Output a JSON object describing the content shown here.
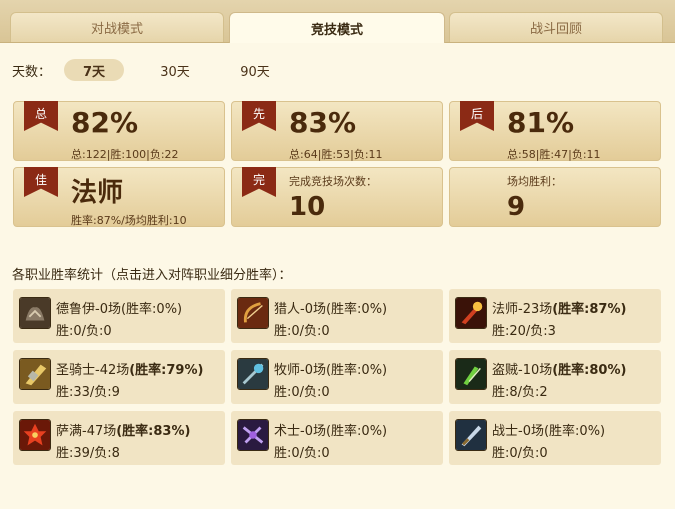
{
  "tabs": [
    {
      "label": "对战模式",
      "active": false
    },
    {
      "label": "竞技模式",
      "active": true
    },
    {
      "label": "战斗回顾",
      "active": false
    }
  ],
  "days": {
    "label": "天数：",
    "options": [
      {
        "label": "7天",
        "active": true
      },
      {
        "label": "30天",
        "active": false
      },
      {
        "label": "90天",
        "active": false
      }
    ]
  },
  "stats": {
    "total": {
      "badge": "总",
      "rate": "82%",
      "detail": "总:122|胜:100|负:22"
    },
    "first": {
      "badge": "先",
      "rate": "83%",
      "detail": "总:64|胜:53|负:11"
    },
    "second": {
      "badge": "后",
      "rate": "81%",
      "detail": "总:58|胜:47|负:11"
    },
    "best": {
      "badge": "佳",
      "class": "法师",
      "detail": "胜率:87%/场均胜利:10"
    },
    "complete": {
      "badge": "完",
      "label": "完成竞技场次数：",
      "value": "10"
    },
    "avg": {
      "label": "场均胜利：",
      "value": "9"
    }
  },
  "section_title": "各职业胜率统计（点击进入对阵职业细分胜率）：",
  "classes": [
    {
      "name": "德鲁伊-0场",
      "rate": "(胜率:0%)",
      "wl": "胜:0/负:0",
      "icon": "druid-icon",
      "bold": false
    },
    {
      "name": "猎人-0场",
      "rate": "(胜率:0%)",
      "wl": "胜:0/负:0",
      "icon": "hunter-icon",
      "bold": false
    },
    {
      "name": "法师-23场",
      "rate": "(胜率:87%)",
      "wl": "胜:20/负:3",
      "icon": "mage-icon",
      "bold": true
    },
    {
      "name": "圣骑士-42场",
      "rate": "(胜率:79%)",
      "wl": "胜:33/负:9",
      "icon": "paladin-icon",
      "bold": true
    },
    {
      "name": "牧师-0场",
      "rate": "(胜率:0%)",
      "wl": "胜:0/负:0",
      "icon": "priest-icon",
      "bold": false
    },
    {
      "name": "盗贼-10场",
      "rate": "(胜率:80%)",
      "wl": "胜:8/负:2",
      "icon": "rogue-icon",
      "bold": true
    },
    {
      "name": "萨满-47场",
      "rate": "(胜率:83%)",
      "wl": "胜:39/负:8",
      "icon": "shaman-icon",
      "bold": true
    },
    {
      "name": "术士-0场",
      "rate": "(胜率:0%)",
      "wl": "胜:0/负:0",
      "icon": "warlock-icon",
      "bold": false
    },
    {
      "name": "战士-0场",
      "rate": "(胜率:0%)",
      "wl": "胜:0/负:0",
      "icon": "warrior-icon",
      "bold": false
    }
  ]
}
